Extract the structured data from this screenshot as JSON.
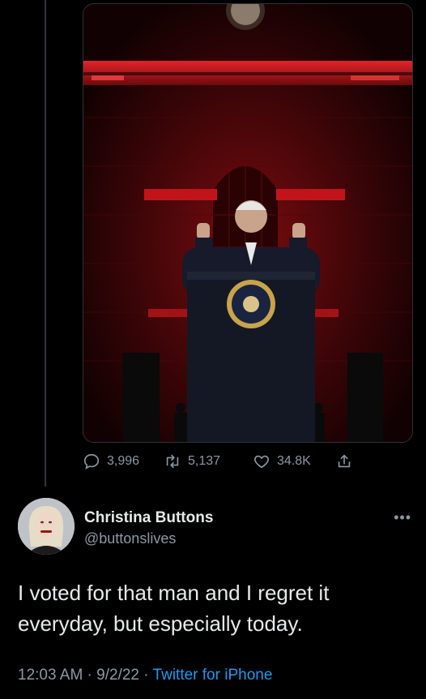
{
  "stats": {
    "replies": "3,996",
    "retweets": "5,137",
    "likes": "34.8K"
  },
  "author": {
    "name": "Christina Buttons",
    "handle": "@buttonslives"
  },
  "tweet": {
    "line1": "I voted for that man and I regret it",
    "line2": "everyday, but especially today."
  },
  "meta": {
    "time": "12:03 AM",
    "sep1": " · ",
    "date": "9/2/22",
    "sep2": " · ",
    "source": "Twitter for iPhone"
  },
  "colors": {
    "background": "#000000",
    "secondary_text": "#8b98a5",
    "link": "#1d9bf0",
    "stage_red": "#c0141a"
  },
  "icons": [
    "reply-icon",
    "retweet-icon",
    "like-icon",
    "share-icon",
    "more-icon"
  ]
}
